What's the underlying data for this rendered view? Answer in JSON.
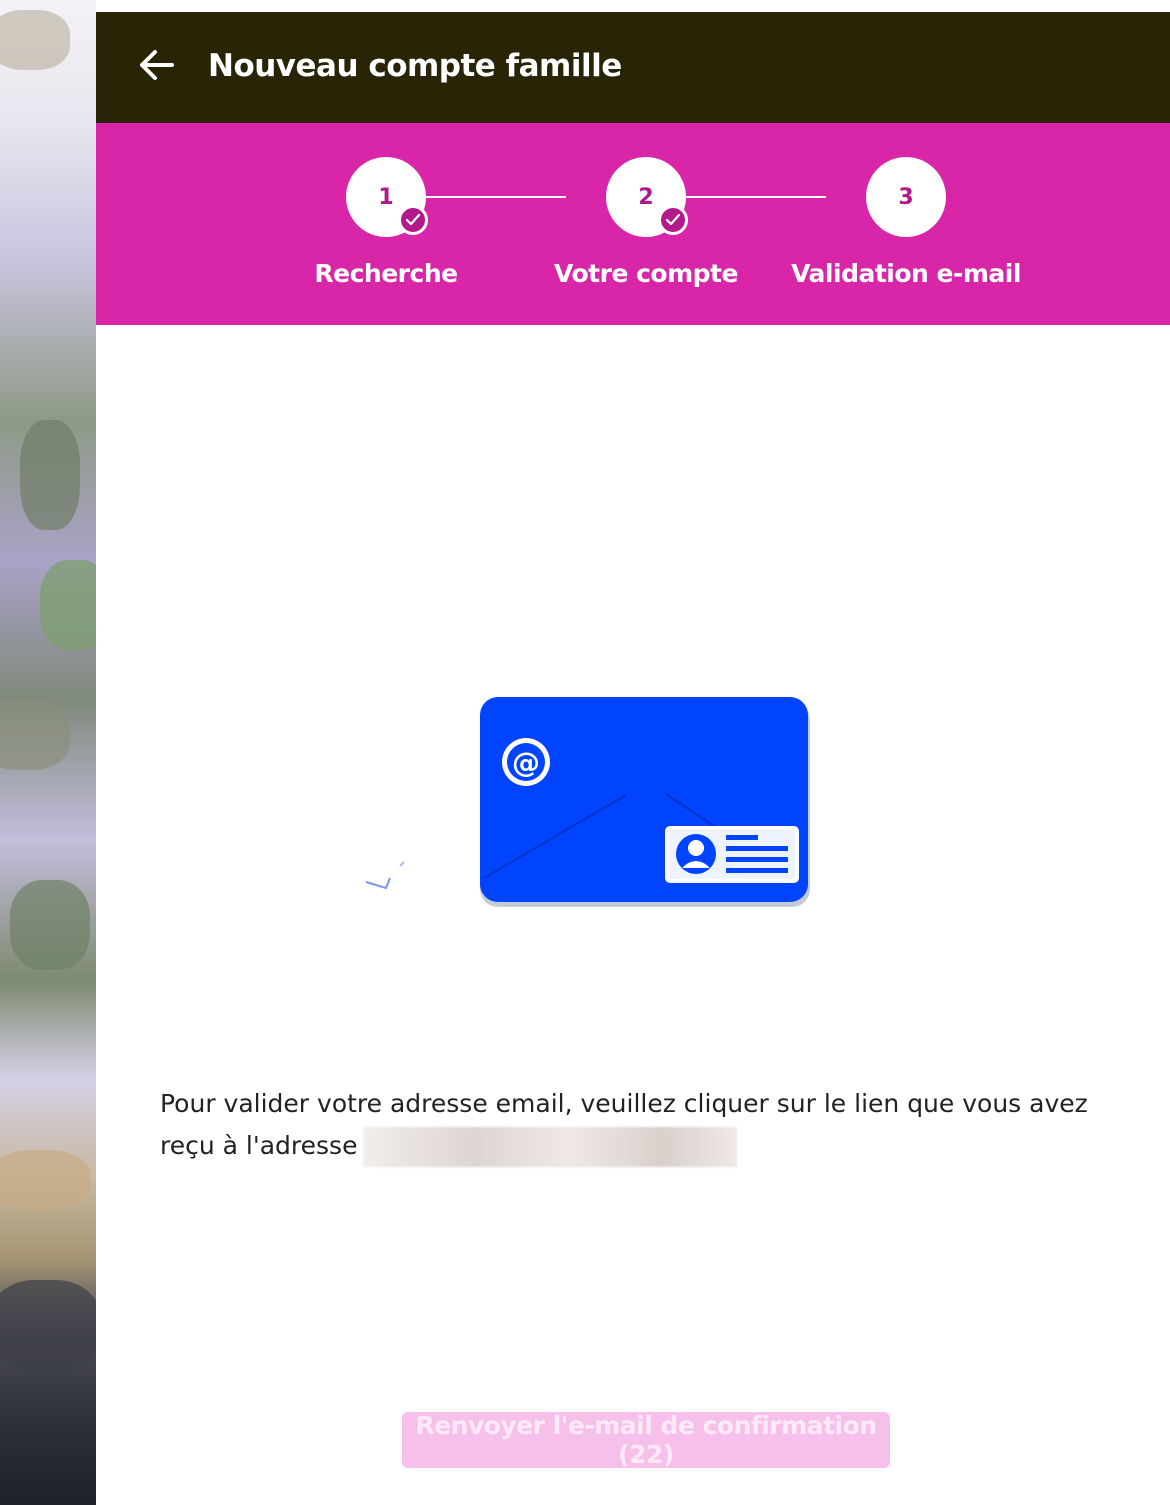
{
  "header": {
    "back_icon": "arrow-left-icon",
    "title": "Nouveau compte famille",
    "background": "#2a2406"
  },
  "stepper": {
    "background": "#d926a9",
    "steps": [
      {
        "number": "1",
        "label": "Recherche",
        "completed": true
      },
      {
        "number": "2",
        "label": "Votre compte",
        "completed": true
      },
      {
        "number": "3",
        "label": "Validation e-mail",
        "completed": false
      }
    ]
  },
  "illustration": {
    "icon": "email-envelope-icon",
    "at_symbol": "@",
    "color": "#0044ff"
  },
  "message": {
    "text": "Pour valider votre adresse email, veuillez cliquer sur le lien que vous avez reçu à l'adresse"
  },
  "resend_button": {
    "label": "Renvoyer l'e-mail de confirmation (22)",
    "disabled": true
  }
}
